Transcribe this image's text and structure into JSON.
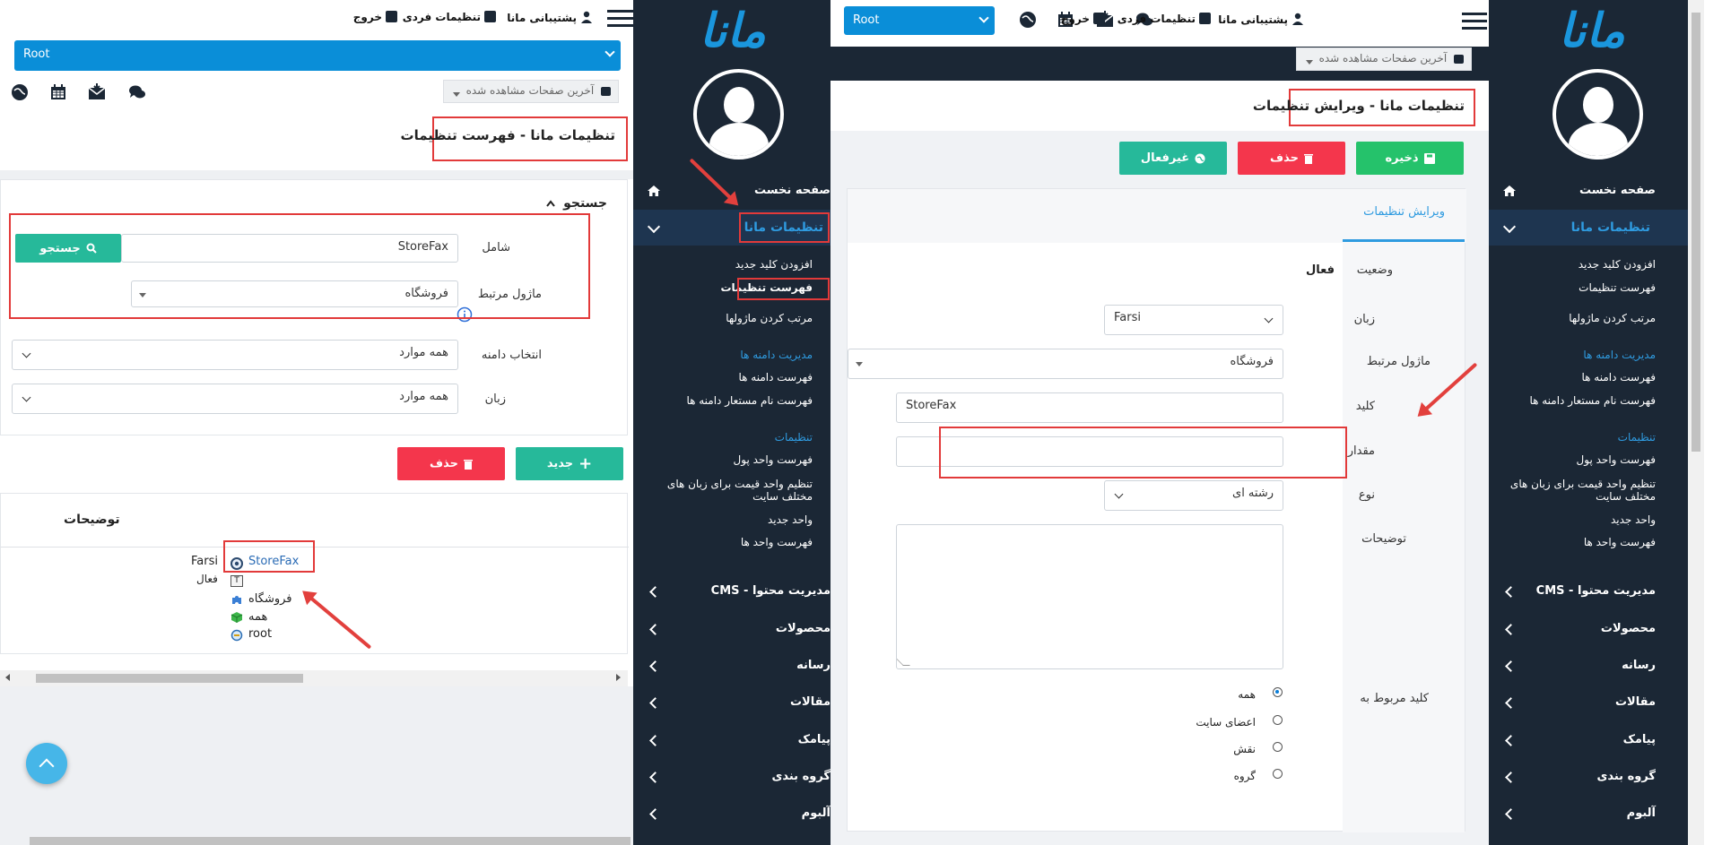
{
  "left": {
    "topbar": {
      "logout": "خروج",
      "personal_settings": "تنظیمات فردی",
      "support": "پشتیبانی مانا"
    },
    "root_select": "Root",
    "recent_pages": "آخرین صفحات مشاهده شده",
    "page_title": "تنظیمات مانا - فهرست تنظیمات",
    "search": {
      "header": "جستجو",
      "contains_label": "شامل",
      "contains_value": "StoreFax",
      "search_button": "جستجو",
      "module_label": "ماژول مرتبط",
      "module_value": "فروشگاه",
      "domain_label": "انتخاب دامنه",
      "domain_value": "همه موارد",
      "language_label": "زبان",
      "language_value": "همه موارد"
    },
    "new_button": "جدید",
    "delete_button": "حذف",
    "table": {
      "description_header": "توضیحات",
      "row": {
        "key": "StoreFax",
        "language": "Farsi",
        "status": "فعال",
        "module": "فروشگاه",
        "scope": "همه",
        "domain": "root"
      }
    }
  },
  "sidebar": {
    "logo": "مانا",
    "home": "صفحه نخست",
    "mana_settings": "تنظیمات مانا",
    "add_new_key": "افزودن کلید جدید",
    "settings_list": "فهرست تنظیمات",
    "sort_modules": "مرتب کردن ماژولها",
    "domain_mgmt_header": "مدیریت دامنه ها",
    "domains_list": "فهرست دامنه ها",
    "domain_alias_list": "فهرست نام مستعار دامنه ها",
    "settings_header": "تنظیمات",
    "currency_list": "فهرست واحد پول",
    "currency_price_line1": "تنظیم واحد قیمت برای زبان های",
    "currency_price_line2": "مختلف سایت",
    "new_unit": "واحد جدید",
    "unit_list": "فهرست واحد ها",
    "cms": "مدیریت محتوا - CMS",
    "products": "محصولات",
    "media": "رسانه",
    "articles": "مقالات",
    "sms": "پیامک",
    "grouping": "گروه بندی",
    "album": "آلبوم"
  },
  "mid": {
    "root_select": "Root",
    "topbar": {
      "logout": "خروج",
      "personal_settings": "تنظیمات فردی",
      "support": "پشتیبانی مانا"
    },
    "recent_pages": "آخرین صفحات مشاهده شده",
    "page_title": "تنظیمات مانا - ویرایش تنظیمات",
    "save_button": "ذخیره",
    "delete_button": "حذف",
    "disable_button": "غیرفعال",
    "tab_edit": "ویرایش تنظیمات",
    "form": {
      "status_label": "وضعیت",
      "status_value": "فعال",
      "language_label": "زبان",
      "language_value": "Farsi",
      "module_label": "ماژول مرتبط",
      "module_value": "فروشگاه",
      "key_label": "کلید",
      "key_value": "StoreFax",
      "value_label": "مقدار",
      "value_value": "",
      "type_label": "نوع",
      "type_value": "رشته ای",
      "description_label": "توضیحات",
      "related_key_label": "کلید مربوط به",
      "radio_all": "همه",
      "radio_members": "اعضای سایت",
      "radio_role": "نقش",
      "radio_group": "گروه"
    }
  },
  "colors": {
    "sidebar_bg": "#1b2735",
    "accent_blue": "#0a8ed8",
    "teal": "#26b99a",
    "red": "#f4364c",
    "green": "#25c26b",
    "highlight_red": "#e23a3a"
  }
}
